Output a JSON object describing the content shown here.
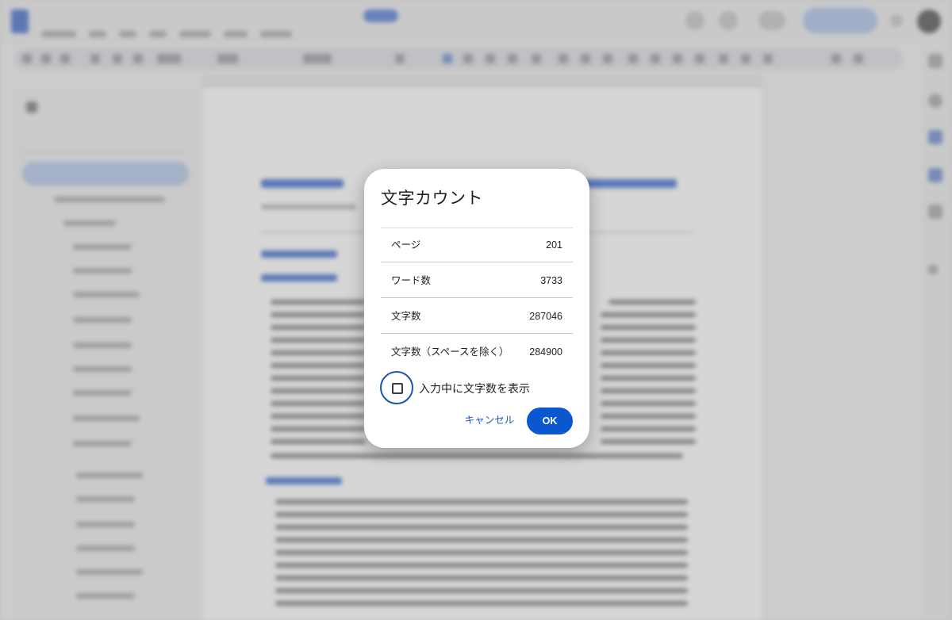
{
  "dialog": {
    "title": "文字カウント",
    "stats": [
      {
        "label": "ページ",
        "value": "201"
      },
      {
        "label": "ワード数",
        "value": "3733"
      },
      {
        "label": "文字数",
        "value": "287046"
      },
      {
        "label": "文字数（スペースを除く）",
        "value": "284900"
      }
    ],
    "checkbox": {
      "label": "入力中に文字数を表示",
      "checked": false
    },
    "cancel_label": "キャンセル",
    "ok_label": "OK"
  },
  "colors": {
    "primary": "#0b57d0",
    "cancel_text": "#1f57bf",
    "scrim": "rgba(0,0,0,0.16)"
  }
}
